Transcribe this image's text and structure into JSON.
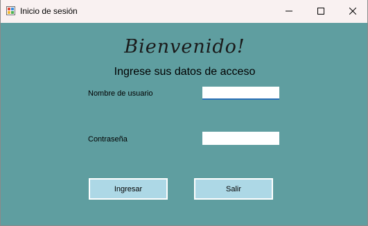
{
  "window": {
    "title": "Inicio de sesión",
    "icon": "windows-forms-app-icon",
    "controls": {
      "minimize_icon": "minimize-icon",
      "maximize_icon": "maximize-icon",
      "close_icon": "close-icon"
    }
  },
  "form": {
    "heading": "Bienvenido!",
    "subheading": "Ingrese sus datos de acceso",
    "username": {
      "label": "Nombre de usuario",
      "value": ""
    },
    "password": {
      "label": "Contraseña",
      "value": ""
    },
    "buttons": {
      "login": "Ingresar",
      "exit": "Salir"
    }
  },
  "colors": {
    "background": "#5f9ea0",
    "titlebar": "#f9f1f1",
    "button": "#add8e6",
    "focus_underline": "#2a6fb6"
  }
}
